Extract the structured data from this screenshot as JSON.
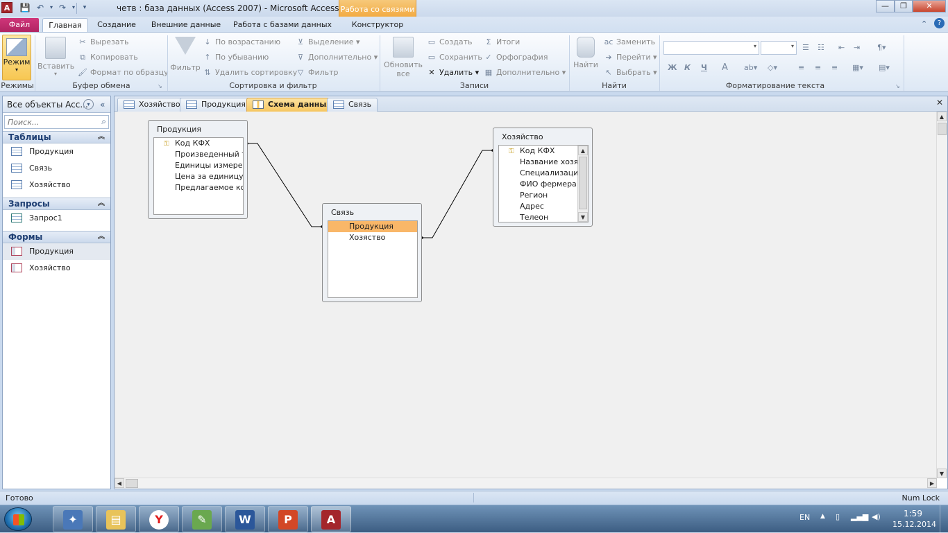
{
  "window": {
    "title": "четв : база данных (Access 2007)  -  Microsoft Access",
    "context_header": "Работа со связями",
    "minimize": "—",
    "maximize": "❐",
    "close": "✕"
  },
  "ribbon_tabs": [
    "Файл",
    "Главная",
    "Создание",
    "Внешние данные",
    "Работа с базами данных",
    "Конструктор"
  ],
  "ribbon": {
    "views": {
      "group": "Режимы",
      "mode": "Режим"
    },
    "clipboard": {
      "group": "Буфер обмена",
      "paste": "Вставить",
      "cut": "Вырезать",
      "copy": "Копировать",
      "format_painter": "Формат по образцу"
    },
    "sort_filter": {
      "group": "Сортировка и фильтр",
      "filter": "Фильтр",
      "ascending": "По возрастанию",
      "descending": "По убыванию",
      "remove_sort": "Удалить сортировку",
      "selection": "Выделение",
      "advanced": "Дополнительно",
      "toggle_filter": "Фильтр"
    },
    "records": {
      "group": "Записи",
      "refresh_line1": "Обновить",
      "refresh_line2": "все",
      "new": "Создать",
      "save": "Сохранить",
      "delete": "Удалить",
      "totals": "Итоги",
      "spelling": "Орфография",
      "more": "Дополнительно"
    },
    "find": {
      "group": "Найти",
      "find": "Найти",
      "replace": "Заменить",
      "goto": "Перейти",
      "select": "Выбрать"
    },
    "text_format": {
      "group": "Форматирование текста",
      "bold": "Ж",
      "italic": "К",
      "underline": "Ч",
      "font_color": "A"
    }
  },
  "nav": {
    "header": "Все объекты Acc...",
    "search_placeholder": "Поиск...",
    "groups": [
      {
        "label": "Таблицы",
        "items": [
          "Продукция",
          "Связь",
          "Хозяйство"
        ]
      },
      {
        "label": "Запросы",
        "items": [
          "Запрос1"
        ]
      },
      {
        "label": "Формы",
        "items": [
          "Продукция",
          "Хозяйство"
        ]
      }
    ]
  },
  "doc_tabs": [
    "Хозяйство",
    "Продукция",
    "Схема данных",
    "Связь"
  ],
  "active_doc_tab": "Схема данных",
  "diagram": {
    "tables": [
      {
        "name": "Продукция",
        "fields": [
          "Код КФХ",
          "Произведенный т",
          "Единицы измерен",
          "Цена за единицу т",
          "Предлагаемое кол"
        ],
        "key_field": "Код КФХ"
      },
      {
        "name": "Связь",
        "fields": [
          "Продукция",
          "Хозяство"
        ],
        "selected_field": "Продукция"
      },
      {
        "name": "Хозяйство",
        "fields": [
          "Код КФХ",
          "Название хозяй",
          "Специализаци",
          "ФИО фермера",
          "Регион",
          "Адрес",
          "Телеон"
        ],
        "key_field": "Код КФХ"
      }
    ]
  },
  "status": {
    "left": "Готово",
    "right": "Num Lock"
  },
  "taskbar": {
    "apps": [
      "desktop-tools",
      "explorer",
      "yandex",
      "paint",
      "word",
      "powerpoint",
      "access"
    ],
    "lang": "EN",
    "time": "1:59",
    "date": "15.12.2014"
  },
  "colors": {
    "accent_file_tab": "#b02462",
    "context_tab": "#f2a63a",
    "selected_field": "#f9b768",
    "nav_group_text": "#1f3f73"
  }
}
